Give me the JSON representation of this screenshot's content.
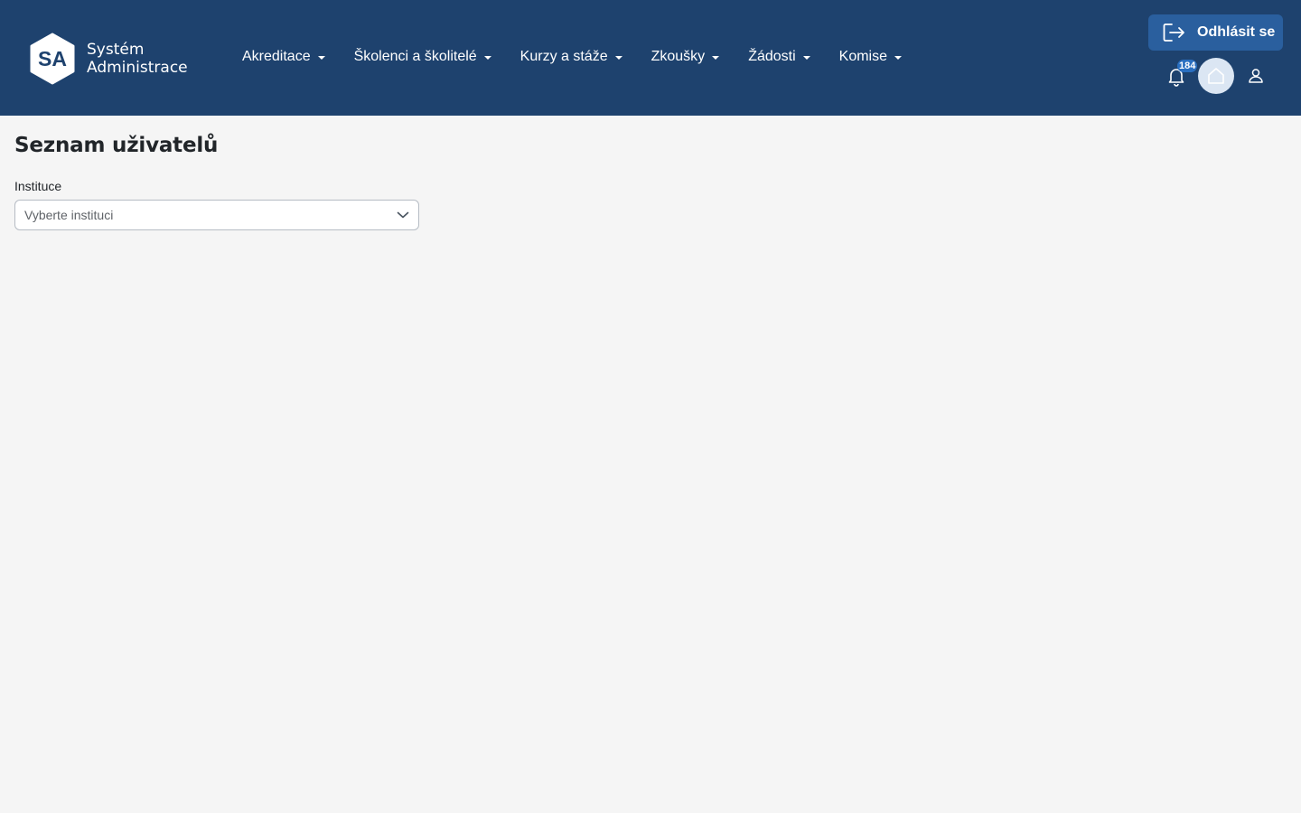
{
  "header": {
    "logo": {
      "badge_text": "SA",
      "line1": "Systém",
      "line2": "Administrace"
    },
    "nav": [
      {
        "label": "Akreditace"
      },
      {
        "label": "Školenci a školitelé"
      },
      {
        "label": "Kurzy a stáže"
      },
      {
        "label": "Zkoušky"
      },
      {
        "label": "Žádosti"
      },
      {
        "label": "Komise"
      }
    ],
    "logout_label": "Odhlásit se",
    "notifications_count": "184",
    "icons": {
      "logout": "logout-icon",
      "bell": "bell-icon",
      "home": "home-icon",
      "user": "user-icon",
      "caret": "caret-down-icon",
      "chevron": "chevron-down-icon"
    }
  },
  "main": {
    "title": "Seznam uživatelů",
    "institution_field": {
      "label": "Instituce",
      "placeholder": "Vyberte instituci"
    }
  },
  "colors": {
    "header_bg": "#1e426e",
    "logout_bg": "#2a5f9e",
    "page_bg": "#f5f5f5",
    "badge_bg": "#2a6fc0"
  }
}
